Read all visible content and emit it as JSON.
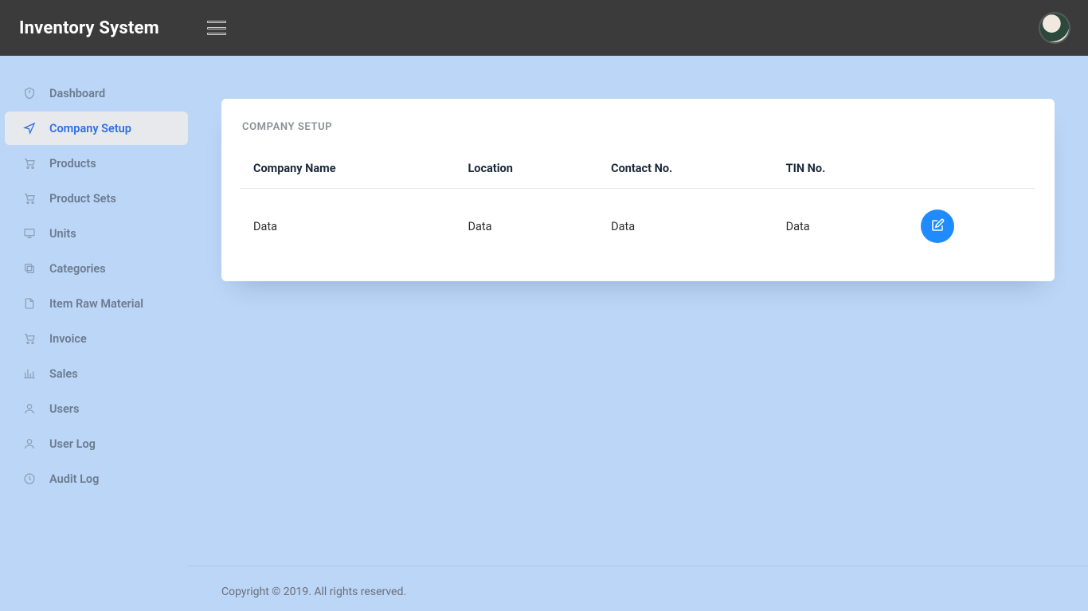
{
  "colors": {
    "accent": "#2f6fe4",
    "button": "#1f8bff",
    "body_bg": "#bbd6f7",
    "header_bg": "#3b3b3b"
  },
  "app": {
    "title": "Inventory System"
  },
  "sidebar": {
    "items": [
      {
        "label": "Dashboard",
        "icon": "shield-icon"
      },
      {
        "label": "Company Setup",
        "icon": "nav-arrow-icon",
        "active": true
      },
      {
        "label": "Products",
        "icon": "cart-icon"
      },
      {
        "label": "Product Sets",
        "icon": "cart-icon"
      },
      {
        "label": "Units",
        "icon": "monitor-icon"
      },
      {
        "label": "Categories",
        "icon": "stack-icon"
      },
      {
        "label": "Item Raw Material",
        "icon": "file-icon"
      },
      {
        "label": "Invoice",
        "icon": "cart-icon"
      },
      {
        "label": "Sales",
        "icon": "bar-chart-icon"
      },
      {
        "label": "Users",
        "icon": "user-icon"
      },
      {
        "label": "User Log",
        "icon": "user-icon"
      },
      {
        "label": "Audit Log",
        "icon": "clock-icon"
      }
    ]
  },
  "main": {
    "card_title": "COMPANY SETUP",
    "columns": [
      "Company Name",
      "Location",
      "Contact No.",
      "TIN No."
    ],
    "rows": [
      {
        "company_name": "Data",
        "location": "Data",
        "contact_no": "Data",
        "tin_no": "Data"
      }
    ]
  },
  "footer": {
    "text": "Copyright © 2019. All rights reserved."
  }
}
